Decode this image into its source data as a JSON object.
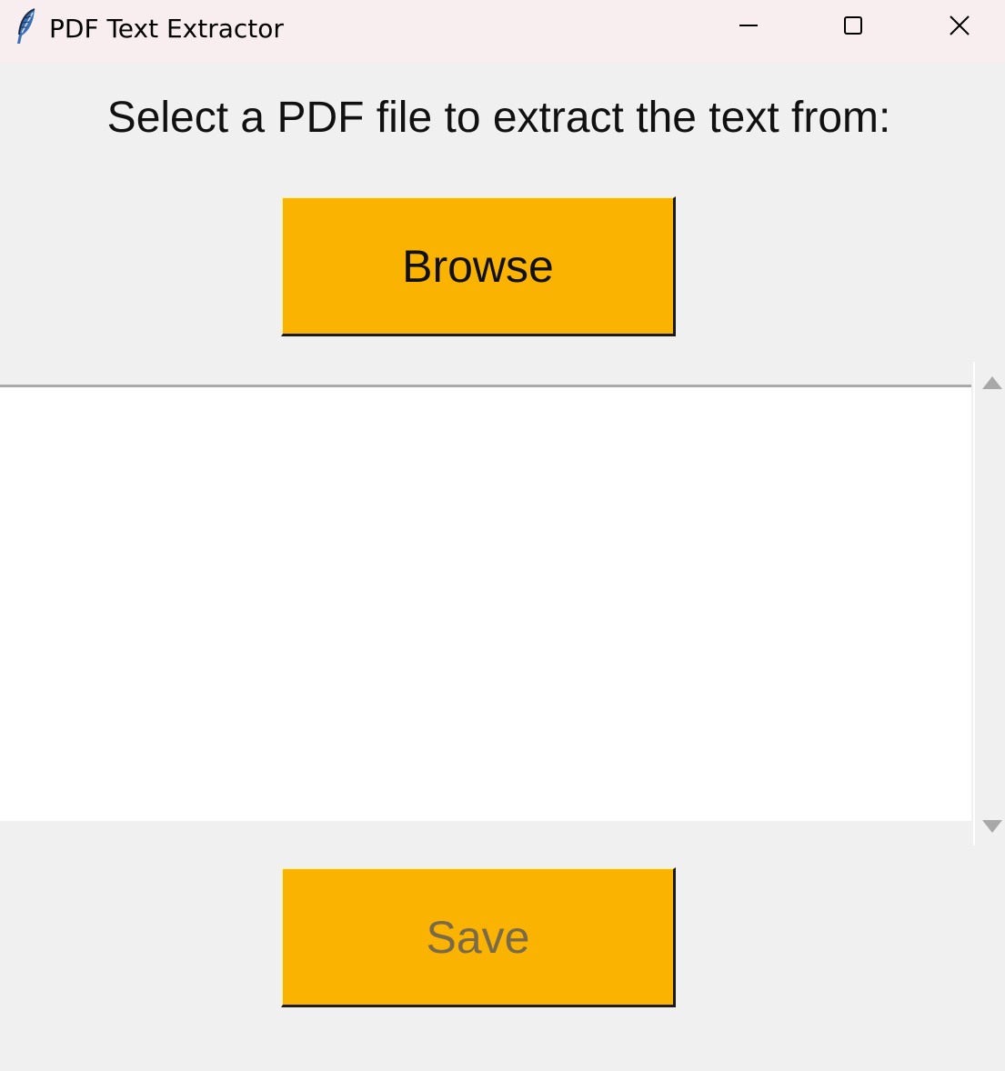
{
  "window": {
    "title": "PDF Text Extractor",
    "icon": "feather-icon",
    "controls": {
      "minimize_icon": "minimize-icon",
      "maximize_icon": "maximize-icon",
      "close_icon": "close-icon"
    }
  },
  "main": {
    "prompt": "Select a PDF file to extract the text from:",
    "browse_label": "Browse",
    "text_output": "",
    "save_label": "Save",
    "save_enabled": false
  },
  "colors": {
    "button_bg": "#f9b300",
    "titlebar_bg": "#f9eeef",
    "window_bg": "#f0f0f0"
  }
}
